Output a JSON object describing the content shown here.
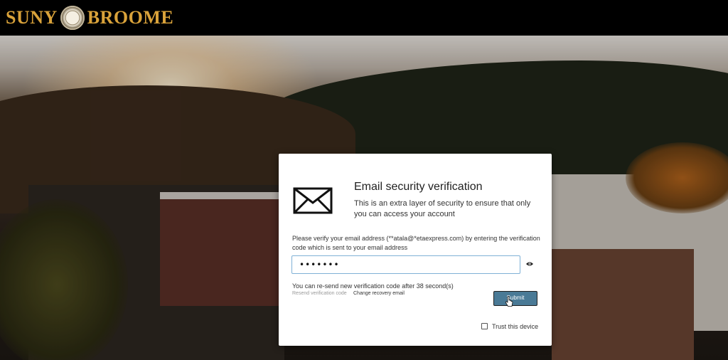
{
  "header": {
    "brand_left": "SUNY",
    "brand_right": "BROOME",
    "logo_icon": "college-seal-icon",
    "colors": {
      "background": "#000000",
      "brand_text": "#d9a23a"
    }
  },
  "dialog": {
    "title": "Email security verification",
    "subtitle": "This is an extra layer of security to ensure that only you can access your account",
    "instructions": "Please verify your email address (**atala@*etaexpress.com) by entering the verification code which is sent to your email address",
    "code_value": "•••••••",
    "resend_message": "You can re-send new verification code after 38 second(s)",
    "resend_link": "Resend verification code",
    "change_recovery_link": "Change recovery email",
    "submit_label": "Submit",
    "trust_label": "Trust this device",
    "icons": [
      "envelope-icon",
      "eye-icon",
      "pointer-cursor-icon"
    ],
    "colors": {
      "submit_bg": "#4a7a96",
      "input_border": "#7fb1d6"
    }
  }
}
